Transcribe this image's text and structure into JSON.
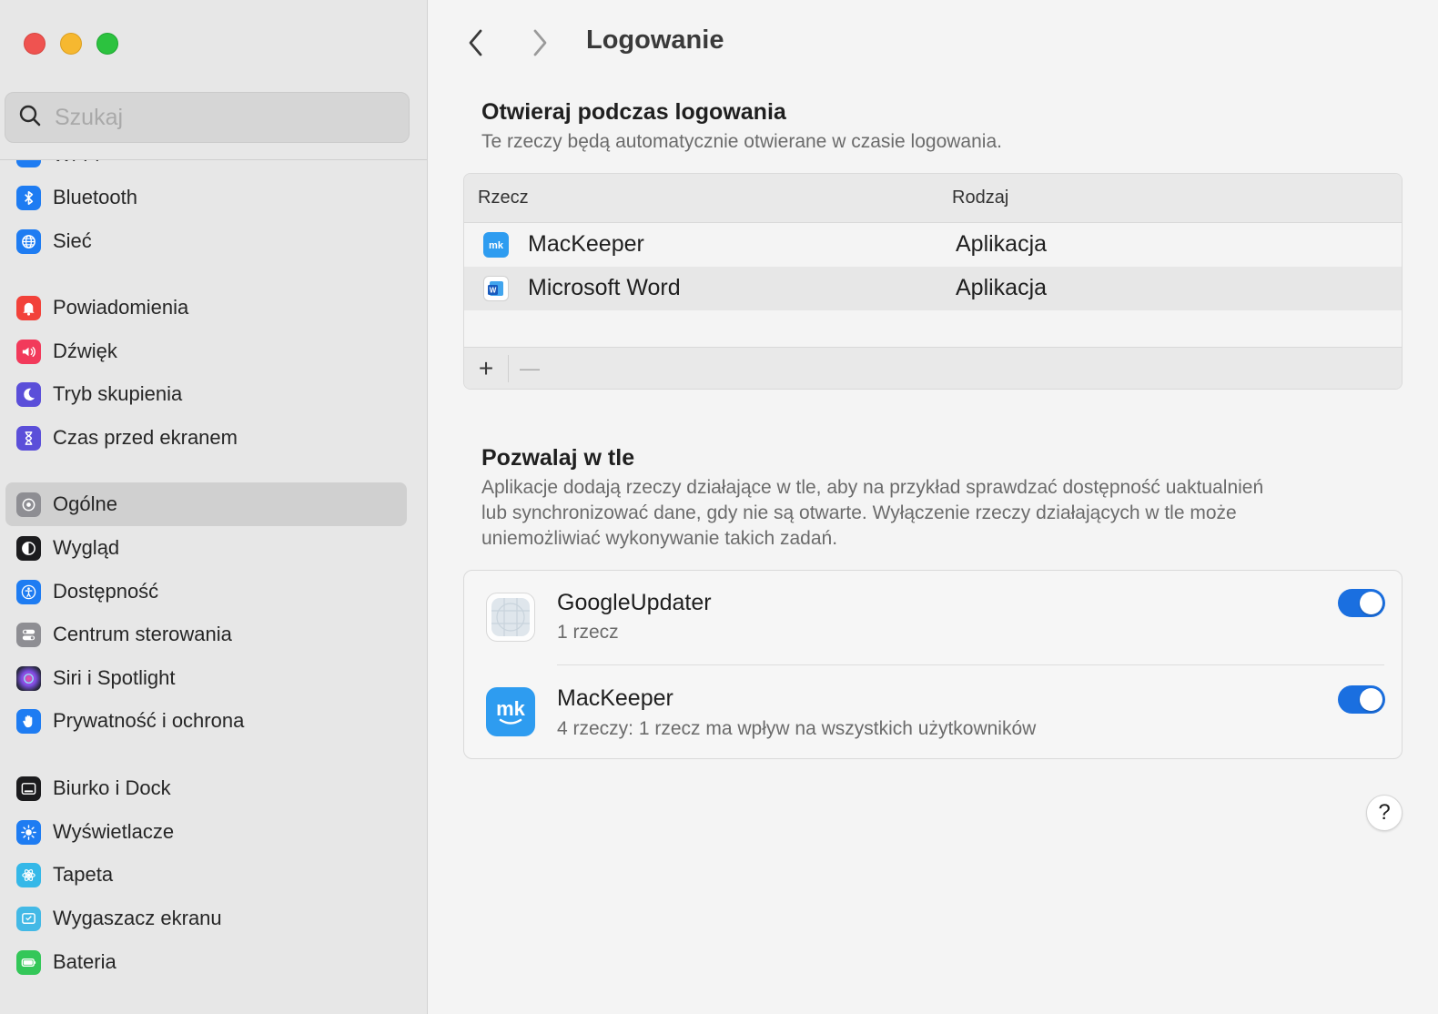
{
  "window": {
    "title": "Logowanie"
  },
  "search": {
    "placeholder": "Szukaj",
    "value": ""
  },
  "sidebar": {
    "selected": "Ogólne",
    "items": [
      {
        "label": "Wi-Fi",
        "icon": "wifi-icon",
        "color": "#1e7cf2"
      },
      {
        "label": "Bluetooth",
        "icon": "bluetooth-icon",
        "color": "#1e7cf2"
      },
      {
        "label": "Sieć",
        "icon": "globe-icon",
        "color": "#1e7cf2"
      },
      {
        "label": "Powiadomienia",
        "icon": "bell-icon",
        "color": "#f2423a"
      },
      {
        "label": "Dźwięk",
        "icon": "speaker-icon",
        "color": "#f23a5b"
      },
      {
        "label": "Tryb skupienia",
        "icon": "moon-icon",
        "color": "#5b4fd9"
      },
      {
        "label": "Czas przed ekranem",
        "icon": "hourglass-icon",
        "color": "#5b4fd9"
      },
      {
        "label": "Ogólne",
        "icon": "gear-icon",
        "color": "#8e8e93"
      },
      {
        "label": "Wygląd",
        "icon": "appearance-icon",
        "color": "#1c1c1e"
      },
      {
        "label": "Dostępność",
        "icon": "accessibility-icon",
        "color": "#1e7cf2"
      },
      {
        "label": "Centrum sterowania",
        "icon": "control-center-icon",
        "color": "#8e8e93"
      },
      {
        "label": "Siri i Spotlight",
        "icon": "siri-icon",
        "color": "#2a2a40"
      },
      {
        "label": "Prywatność i ochrona",
        "icon": "hand-icon",
        "color": "#1e7cf2"
      },
      {
        "label": "Biurko i Dock",
        "icon": "dock-icon",
        "color": "#1c1c1e"
      },
      {
        "label": "Wyświetlacze",
        "icon": "brightness-icon",
        "color": "#1e7cf2"
      },
      {
        "label": "Tapeta",
        "icon": "wallpaper-icon",
        "color": "#35b8e8"
      },
      {
        "label": "Wygaszacz ekranu",
        "icon": "screensaver-icon",
        "color": "#43b9e6"
      },
      {
        "label": "Bateria",
        "icon": "battery-icon",
        "color": "#34c759"
      }
    ]
  },
  "login_section": {
    "title": "Otwieraj podczas logowania",
    "description": "Te rzeczy będą automatycznie otwierane w czasie logowania.",
    "columns": [
      "Rzecz",
      "Rodzaj"
    ],
    "rows": [
      {
        "name": "MacKeeper",
        "kind": "Aplikacja",
        "icon": "mackeeper-icon"
      },
      {
        "name": "Microsoft Word",
        "kind": "Aplikacja",
        "icon": "word-icon"
      }
    ],
    "add_label": "+",
    "remove_label": "—"
  },
  "background_section": {
    "title": "Pozwalaj w tle",
    "description_lines": [
      "Aplikacje dodają rzeczy działające w tle, aby na przykład sprawdzać dostępność uaktualnień",
      "lub synchronizować dane, gdy nie są otwarte. Wyłączenie rzeczy działających w tle może",
      "uniemożliwiać wykonywanie takich zadań."
    ],
    "items": [
      {
        "name": "GoogleUpdater",
        "detail": "1 rzecz",
        "enabled": true,
        "icon": "generic-app-icon"
      },
      {
        "name": "MacKeeper",
        "detail": "4 rzeczy: 1 rzecz ma wpływ na wszystkich użytkowników",
        "enabled": true,
        "icon": "mackeeper-icon"
      }
    ]
  },
  "help": {
    "label": "?"
  },
  "colors": {
    "accent": "#1a6fe0",
    "sidebar_bg": "#e7e7e7",
    "content_bg": "#f4f4f4"
  }
}
